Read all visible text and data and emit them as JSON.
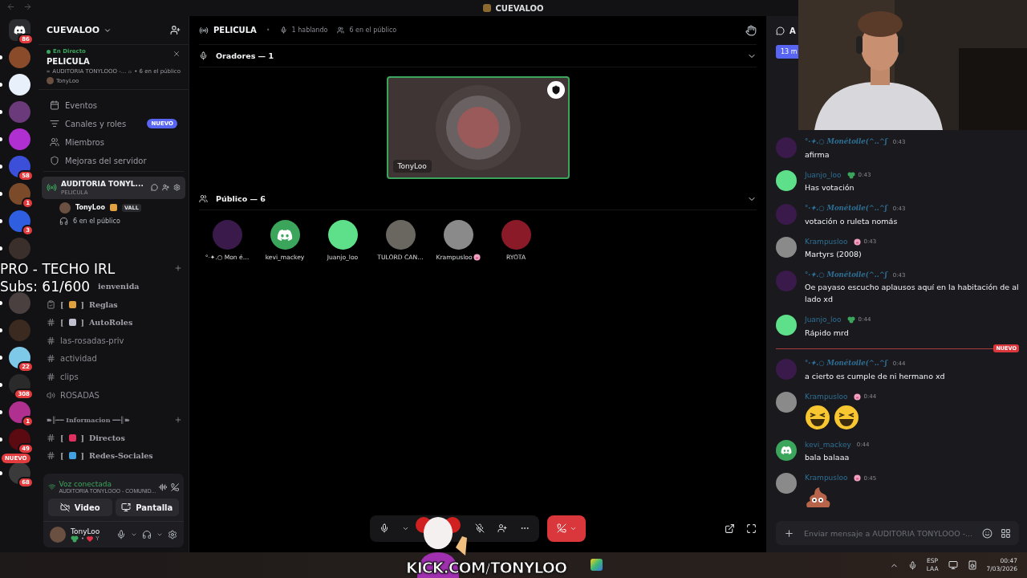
{
  "window": {
    "title": "CUEVALOO"
  },
  "servers": [
    {
      "color": "#2b2d31",
      "kind": "home",
      "badge": "86",
      "unread": false
    },
    {
      "color": "#8a4b2a",
      "unread": true
    },
    {
      "color": "#e8f1fb",
      "unread": true
    },
    {
      "color": "#6b3a7a",
      "unread": true
    },
    {
      "color": "#b02fd0",
      "unread": true
    },
    {
      "color": "#3b4fd8",
      "badge": "58",
      "unread": true
    },
    {
      "color": "#7a4a2a",
      "badge": "1",
      "unread": true
    },
    {
      "color": "#2f5fe0",
      "badge": "3",
      "unread": true
    },
    {
      "color": "#3a2f2a",
      "unread": true
    },
    {
      "color": "#4a4040",
      "unread": true
    },
    {
      "color": "#3a2a20",
      "unread": true
    },
    {
      "color": "#7ec8e8",
      "badge": "22",
      "unread": true
    },
    {
      "color": "#2a2a2a",
      "badge": "308",
      "unread": true
    },
    {
      "color": "#b03090",
      "badge": "1",
      "unread": true
    },
    {
      "color": "#5a0a10",
      "badge": "49",
      "unread": true
    },
    {
      "color": "#3a3a3a",
      "badge": "68",
      "flag": "NUEVO",
      "unread": true
    }
  ],
  "sidebar": {
    "server_name": "CUEVALOO",
    "live": {
      "status": "En Directo",
      "title": "PELICULA",
      "channel": "AUDITORIA TONYLOOO -...",
      "audience": "• 6 en el público",
      "host": "TonyLoo"
    },
    "menu": [
      {
        "kind": "events",
        "label": "Eventos"
      },
      {
        "kind": "channels",
        "label": "Canales y roles",
        "badge": "NUEVO"
      },
      {
        "kind": "members",
        "label": "Miembros"
      },
      {
        "kind": "boost",
        "label": "Mejoras del servidor"
      }
    ],
    "active_channel": {
      "name": "AUDITORIA TONYL...",
      "topic": "PELICULA",
      "speaker": "TonyLoo",
      "speaker_tag": "VALL",
      "audience": "6 en el público"
    },
    "channels": [
      {
        "kind": "covered-category"
      },
      {
        "kind": "covered",
        "name": "ienvenida"
      },
      {
        "kind": "rules",
        "open": "[",
        "emoji": {
          "kind": "scroll"
        },
        "close": "]",
        "name": "Reglas"
      },
      {
        "kind": "text",
        "open": "[",
        "emoji": {
          "kind": "dice"
        },
        "close": "]",
        "name": "AutoRoles"
      },
      {
        "kind": "locked",
        "name": "las-rosadas-priv"
      },
      {
        "kind": "locked",
        "name": "actividad"
      },
      {
        "kind": "locked",
        "name": "clips"
      },
      {
        "kind": "voice",
        "name": "ROSADAS"
      },
      {
        "kind": "category",
        "name": "➽╟━━ Informacion ━━╢➽"
      },
      {
        "kind": "text",
        "open": "[",
        "emoji": {
          "kind": "megaphone"
        },
        "close": "]",
        "name": "Directos"
      },
      {
        "kind": "text",
        "open": "[",
        "emoji": {
          "kind": "gem"
        },
        "close": "]",
        "name": "Redes-Sociales"
      }
    ],
    "voice": {
      "status": "Voz conectada",
      "channel": "AUDITORIA TONYLOOO - COMUNID...",
      "buttons": [
        {
          "kind": "video",
          "label": "Video"
        },
        {
          "kind": "screen",
          "label": "Pantalla"
        }
      ]
    },
    "user": {
      "name": "TonyLoo",
      "separator": "•",
      "status": "Y"
    }
  },
  "overlay": {
    "lines": [
      "PRO - TECHO IRL",
      "Subs: 61/600"
    ],
    "banner": "KICK.COM/TONYLOO"
  },
  "stage": {
    "title": "PELICULA",
    "separator": "•",
    "speaking": "1 hablando",
    "audience": "6 en el público",
    "speakers_heading": "Oradores — 1",
    "speaker": {
      "name": "TonyLoo",
      "speaking": true,
      "color": "#9a5a5a"
    },
    "audience_heading": "Público — 6",
    "listeners": [
      {
        "name": "°·✦.○ Mon é…",
        "color": "#3a1a4a"
      },
      {
        "name": "kevi_mackey",
        "color": "#3ba55c",
        "kind": "default"
      },
      {
        "name": "Juanjo_loo",
        "color": "#5ee08a"
      },
      {
        "name": "TULORD CAN…",
        "color": "#6a6660"
      },
      {
        "name": "Krampusloo",
        "color": "#8a8a8a",
        "badge": {
          "kind": "pig"
        }
      },
      {
        "name": "RYOTA",
        "color": "#8a1a28"
      }
    ]
  },
  "chat": {
    "header": "A",
    "notice": "13 m",
    "messages": [
      {
        "kind": "message",
        "author": "°·✦.○ Monétoile(^..^ʃ",
        "fancy": true,
        "time": "0:43",
        "text": "afirma",
        "color": "#3a1a4a"
      },
      {
        "kind": "message",
        "author": "Juanjo_loo",
        "badge": {
          "kind": "clover"
        },
        "time": "0:43",
        "text": "Has votación",
        "color": "#5ee08a"
      },
      {
        "kind": "message",
        "author": "°·✦.○ Monétoile(^..^ʃ",
        "fancy": true,
        "time": "0:43",
        "text": "votación o ruleta nomás",
        "color": "#3a1a4a"
      },
      {
        "kind": "message",
        "author": "Krampusloo",
        "badge": {
          "kind": "pig"
        },
        "time": "0:43",
        "text": "Martyrs (2008)",
        "color": "#8a8a8a"
      },
      {
        "kind": "message",
        "author": "°·✦.○ Monétoile(^..^ʃ",
        "fancy": true,
        "time": "0:43",
        "text": "Oe payaso escucho aplausos aquí en la habitación de al lado xd",
        "color": "#3a1a4a"
      },
      {
        "kind": "message",
        "author": "Juanjo_loo",
        "badge": {
          "kind": "clover"
        },
        "time": "0:44",
        "text": "Rápido mrd",
        "color": "#5ee08a"
      },
      {
        "kind": "divider",
        "label": "NUEVO"
      },
      {
        "kind": "message",
        "author": "°·✦.○ Monétoile(^..^ʃ",
        "fancy": true,
        "time": "0:44",
        "text": "a cierto es cumple de ni hermano xd",
        "color": "#3a1a4a"
      },
      {
        "kind": "message",
        "author": "Krampusloo",
        "badge": {
          "kind": "pig"
        },
        "time": "0:44",
        "emojis": [
          {
            "kind": "laughing"
          },
          {
            "kind": "laughing"
          }
        ],
        "color": "#8a8a8a"
      },
      {
        "kind": "message",
        "author": "kevi_mackey",
        "time": "0:44",
        "text": "bala balaaa",
        "color": "#3ba55c",
        "avatar": {
          "kind": "default"
        }
      },
      {
        "kind": "message",
        "author": "Krampusloo",
        "badge": {
          "kind": "pig"
        },
        "time": "0:45",
        "emojis": [
          {
            "kind": "poo"
          }
        ],
        "color": "#8a8a8a"
      }
    ],
    "placeholder": "Enviar mensaje a AUDITORIA TONYLOOO -..."
  },
  "taskbar": {
    "language": "ESP",
    "layout": "LAA",
    "time": "00:47",
    "date": "7/03/2026"
  }
}
